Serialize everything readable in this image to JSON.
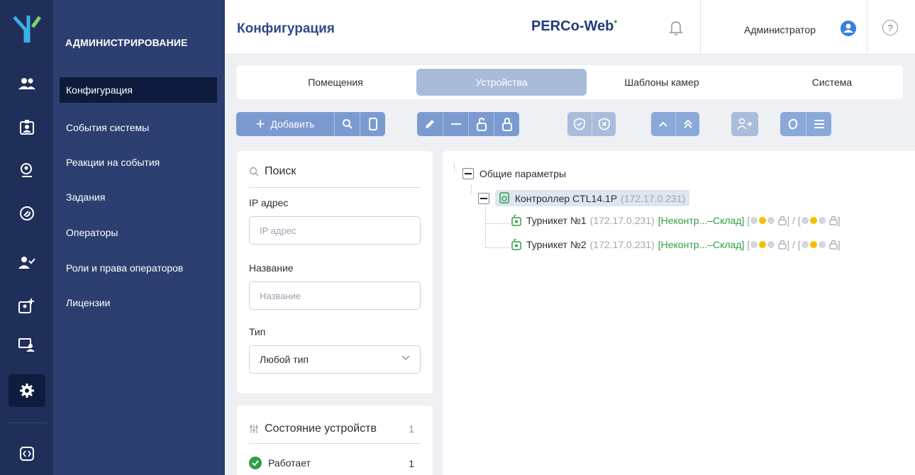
{
  "rail": {
    "icons": [
      "logo-icon",
      "users-icon",
      "employee-card-icon",
      "visitor-icon",
      "access-icon",
      "verified-user-icon",
      "add-card-icon",
      "monitor-user-icon",
      "gear-icon",
      "collapse-icon"
    ]
  },
  "sidebar": {
    "title": "АДМИНИСТРИРОВАНИЕ",
    "items": [
      {
        "label": "Конфигурация",
        "active": true
      },
      {
        "label": "События системы"
      },
      {
        "label": "Реакции на события"
      },
      {
        "label": "Задания"
      },
      {
        "label": "Операторы"
      },
      {
        "label": "Роли и права операторов"
      },
      {
        "label": "Лицензии"
      }
    ]
  },
  "header": {
    "title": "Конфигурация",
    "brand": "PERCo-Web",
    "brand_dot": "•",
    "user": "Администратор",
    "help": "?"
  },
  "tabs": [
    {
      "label": "Помещения"
    },
    {
      "label": "Устройства",
      "active": true
    },
    {
      "label": "Шаблоны камер"
    },
    {
      "label": "Система"
    }
  ],
  "toolbar": {
    "add_label": "Добавить",
    "add_plus": "+"
  },
  "search": {
    "title": "Поиск",
    "ip_label": "IP адрес",
    "ip_placeholder": "IP адрес",
    "name_label": "Название",
    "name_placeholder": "Название",
    "type_label": "Тип",
    "type_value": "Любой тип"
  },
  "status": {
    "title": "Состояние устройств",
    "count": "1",
    "rows": [
      {
        "label": "Работает",
        "count": "1"
      }
    ]
  },
  "tree": {
    "root": "Общие параметры",
    "controller": {
      "name": "Контроллер CTL14.1P",
      "ip": "(172.17.0.231)"
    },
    "children": [
      {
        "name": "Турникет №1",
        "ip": "(172.17.0.231)",
        "zone": "[Неконтр...–Склад]",
        "open": "[",
        "sep": "] / [",
        "close": "]"
      },
      {
        "name": "Турникет №2",
        "ip": "(172.17.0.231)",
        "zone": "[Неконтр...–Склад]",
        "open": "[",
        "sep": "] / [",
        "close": "]"
      }
    ]
  },
  "colors": {
    "rail": "#1f2f5a",
    "sidebar": "#2c3f70",
    "accent": "#7b9bd0",
    "ok_green": "#2ea043",
    "indicator_yellow": "#f2c200",
    "indicator_gray": "#d2d6dc"
  }
}
